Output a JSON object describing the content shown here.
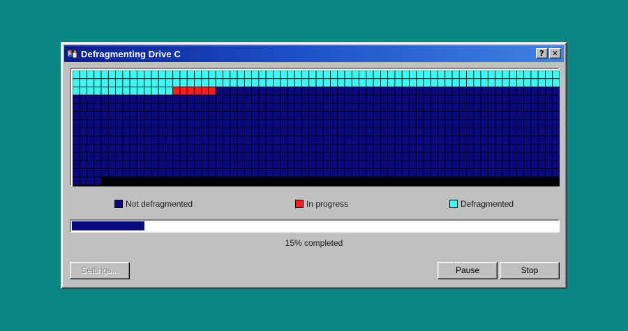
{
  "window": {
    "title": "Defragmenting Drive C",
    "help_button": "?",
    "close_button": "✕"
  },
  "cluster_map": {
    "colors": {
      "not_defragmented": "#0a0a80",
      "in_progress": "#ff1c1c",
      "defragmented": "#3cf7f2",
      "empty": "#000000",
      "grid_line": "#000000"
    },
    "columns": 68,
    "rows": 14,
    "defragmented_count": 150,
    "in_progress_count": 6,
    "used_cells": 888
  },
  "legend": {
    "not_defragmented": "Not defragmented",
    "in_progress": "In progress",
    "defragmented": "Defragmented"
  },
  "progress": {
    "percent": 15,
    "label": "15% completed"
  },
  "buttons": {
    "settings": "Settings...",
    "pause": "Pause",
    "stop": "Stop"
  }
}
